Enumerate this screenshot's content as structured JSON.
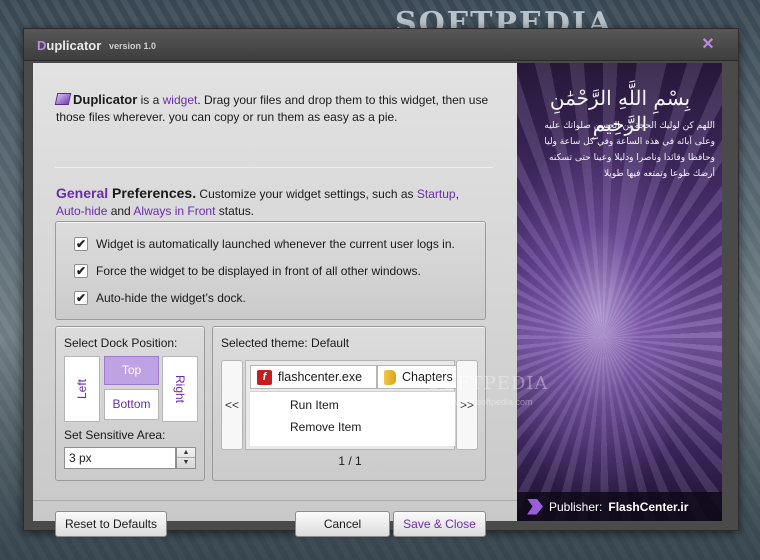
{
  "background": {
    "watermark_top": "SOFTPEDIA",
    "watermark_mid": "SOFTPEDIA",
    "watermark_url": "www.softpedia.com"
  },
  "window": {
    "title_initial": "D",
    "title_rest": "uplicator",
    "version": "version 1.0",
    "close_glyph": "✕"
  },
  "intro": {
    "app_name": "Duplicator",
    "text_1": " is a ",
    "link_widget": "widget",
    "text_2": ". Drag your files and drop them to this widget, then use those files wherever. you can copy or run them as easy as a pie."
  },
  "prefs": {
    "heading_general": "General",
    "heading_rest": " Preferences.",
    "text_1": " Customize your widget settings, such as ",
    "link_startup": "Startup",
    "sep_1": ",",
    "link_autohide": "Auto-hide",
    "text_2": " and ",
    "link_always_front": "Always in Front",
    "text_3": " status."
  },
  "checkboxes": [
    {
      "label": "Widget is automatically launched whenever the current user logs in.",
      "checked": "✔"
    },
    {
      "label": "Force the widget to be displayed in front of all other windows.",
      "checked": "✔"
    },
    {
      "label": "Auto-hide the widget’s dock.",
      "checked": "✔"
    }
  ],
  "dock": {
    "title": "Select Dock Position:",
    "left": "Left",
    "top": "Top",
    "right": "Right",
    "bottom": "Bottom",
    "selected": "Top",
    "sensitive_label": "Set Sensitive Area:",
    "sensitive_value": "3 px"
  },
  "theme": {
    "title": "Selected theme:  Default",
    "prev": "<<",
    "next": ">>",
    "tabs": [
      {
        "label": "flashcenter.exe",
        "icon": "flash-icon"
      },
      {
        "label": "Chapters",
        "icon": "folder-icon"
      }
    ],
    "menu": [
      "Run Item",
      "Remove Item"
    ],
    "page": "1 / 1"
  },
  "buttons": {
    "reset": "Reset to Defaults",
    "cancel": "Cancel",
    "save": "Save & Close"
  },
  "art": {
    "calligraphy": "بِسْمِ اللَّهِ الرَّحْمَٰنِ الرَّحِيمِ",
    "verse": "اللهم كن لوليك الحجة بن الحسن صلواتك عليه وعلى آبائه في هذه الساعة وفي كل ساعة وليا وحافظا وقائدا وناصرا ودليلا وعينا حتى تسكنه أرضك طوعا وتمتعه فيها طويلا",
    "publisher_label": "Publisher:",
    "publisher_name": "FlashCenter.ir"
  },
  "colors": {
    "accent": "#6a2cad",
    "selected_dock": "#bfa2e3"
  }
}
